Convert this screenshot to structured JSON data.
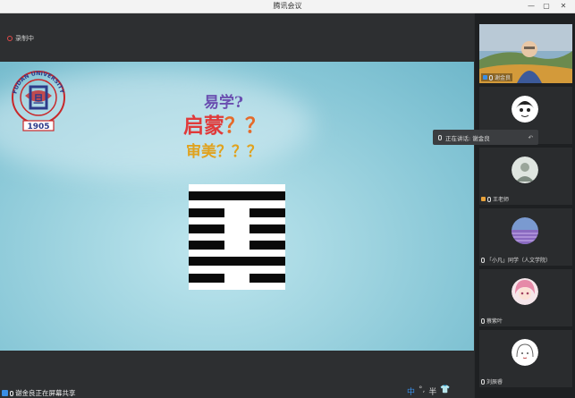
{
  "window": {
    "title": "腾讯会议",
    "minimize": "—",
    "maximize": "▢",
    "close": "✕"
  },
  "recording": {
    "label": "录制中"
  },
  "slide": {
    "line1": "易学?",
    "line2_main": "启蒙",
    "line2_marks": "？？",
    "line3_main": "审美",
    "line3_marks": "？？？",
    "logo_text": "FUDAN UNIVERSITY",
    "logo_year": "1905",
    "logo_center": "复旦"
  },
  "hexagram": {
    "lines": [
      "yang",
      "yin",
      "yin",
      "yin",
      "yang",
      "yin"
    ]
  },
  "bottombar": {
    "share_label": "谢金良正在屏幕共享",
    "ime": [
      "中",
      "°,",
      "半",
      "👕"
    ]
  },
  "toast": {
    "text": "正在讲话: 谢金良"
  },
  "participants": [
    {
      "name": "谢金良",
      "avatar": "video"
    },
    {
      "name": "",
      "avatar": "cartoon-face"
    },
    {
      "name": "王老师",
      "avatar": "photo-round"
    },
    {
      "name": "「小凡」同学（人文学院）",
      "avatar": "lavender-field"
    },
    {
      "name": "蔡紫叶",
      "avatar": "pink-hair-girl"
    },
    {
      "name": "刘辰睿",
      "avatar": "sketch-girl"
    }
  ],
  "colors": {
    "accent": "#3a8ee6",
    "red": "#e03a3a",
    "purple": "#6a4fb0",
    "gold": "#e0a21e"
  }
}
